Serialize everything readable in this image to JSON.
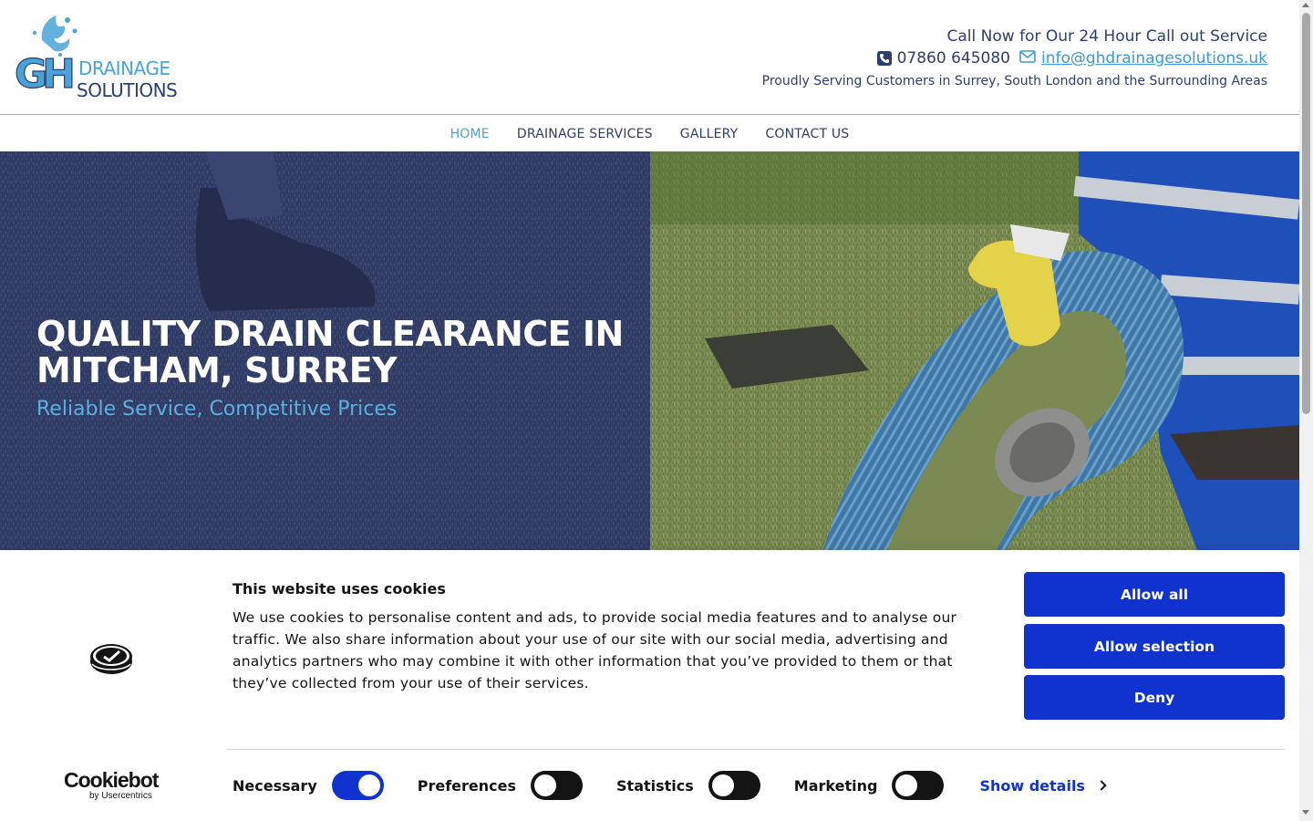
{
  "header": {
    "logo_alt": "GH DRAINAGE SOLUTIONS",
    "logo_initials": "GH",
    "logo_word1": "DRAINAGE",
    "logo_word2": "SOLUTIONS",
    "call_line": "Call Now for Our 24 Hour Call out Service",
    "phone": "07860 645080",
    "email": "info@ghdrainagesolutions.uk",
    "serving_line": "Proudly Serving Customers in Surrey, South London and the Surrounding Areas"
  },
  "nav": {
    "items": [
      {
        "label": "HOME",
        "active": true
      },
      {
        "label": "DRAINAGE SERVICES",
        "active": false
      },
      {
        "label": "GALLERY",
        "active": false
      },
      {
        "label": "CONTACT US",
        "active": false
      }
    ]
  },
  "hero": {
    "title_line1": "QUALITY DRAIN CLEARANCE IN",
    "title_line2": "MITCHAM, SURREY",
    "subtitle": "Reliable Service, Competitive Prices"
  },
  "cookie": {
    "title": "This website uses cookies",
    "text": "We use cookies to personalise content and ads, to provide social media features and to analyse our traffic. We also share information about your use of our site with our social media, advertising and analytics partners who may combine it with other information that you’ve provided to them or that they’ve collected from your use of their services.",
    "buttons": {
      "allow_all": "Allow all",
      "allow_selection": "Allow selection",
      "deny": "Deny"
    },
    "brand_name": "Cookiebot",
    "brand_by": "by Usercentrics",
    "toggles": [
      {
        "label": "Necessary",
        "on": true
      },
      {
        "label": "Preferences",
        "on": false
      },
      {
        "label": "Statistics",
        "on": false
      },
      {
        "label": "Marketing",
        "on": false
      }
    ],
    "show_details": "Show details"
  },
  "colors": {
    "navy": "#2c3e6b",
    "accent_blue": "#4aa3d8",
    "cookie_blue": "#1032cf"
  }
}
